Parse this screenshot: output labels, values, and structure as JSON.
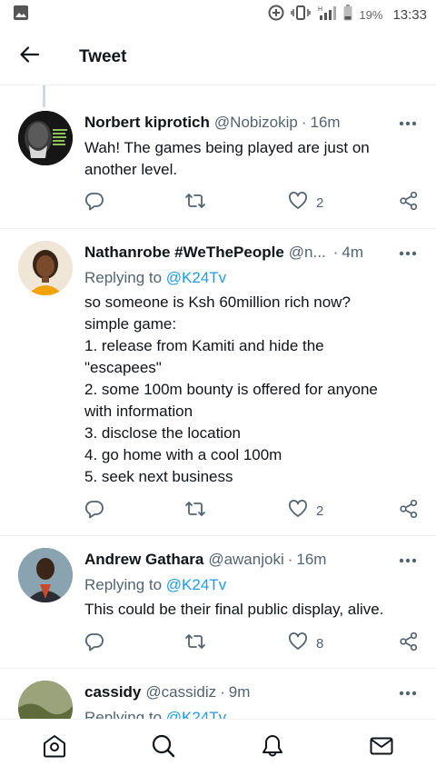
{
  "status_bar": {
    "battery_percent": "19%",
    "time": "13:33",
    "network": "H"
  },
  "header": {
    "title": "Tweet",
    "back_icon": "arrow-left-icon"
  },
  "replies": [
    {
      "name": "Norbert kiprotich",
      "handle": "@Nobizokip",
      "age": "16m",
      "replying_to_label": "",
      "replying_to_mention": "",
      "lines": [
        "Wah! The games being played are just on",
        "another level."
      ],
      "likes": "2",
      "avatar_color": "#1c1c1c"
    },
    {
      "name": "Nathanrobe #WeThePeople",
      "handle": "@n...",
      "age": "4m",
      "replying_to_label": "Replying to",
      "replying_to_mention": "@K24Tv",
      "lines": [
        "so someone is Ksh 60million rich now?",
        "simple game:",
        "1. release from Kamiti and hide the",
        "\"escapees\"",
        "2. some 100m bounty is offered for anyone",
        "with information",
        "3. disclose the location",
        "4. go home with a cool 100m",
        "5. seek next business"
      ],
      "likes": "2",
      "avatar_color": "#e8dccb"
    },
    {
      "name": "Andrew Gathara",
      "handle": "@awanjoki",
      "age": "16m",
      "replying_to_label": "Replying to",
      "replying_to_mention": "@K24Tv",
      "lines": [
        "This could be their final public display, alive."
      ],
      "likes": "8",
      "avatar_color": "#6d8a9c"
    },
    {
      "name": "cassidy",
      "handle": "@cassidiz",
      "age": "9m",
      "replying_to_label": "Replying to",
      "replying_to_mention": "@K24Tv",
      "lines": [],
      "likes": "",
      "avatar_color": "#7a8a5a"
    }
  ],
  "bottom_nav": [
    "home-icon",
    "search-icon",
    "notifications-icon",
    "messages-icon"
  ],
  "colors": {
    "accent": "#1d9bf0",
    "secondary_text": "#536471",
    "divider": "#eff3f4"
  }
}
